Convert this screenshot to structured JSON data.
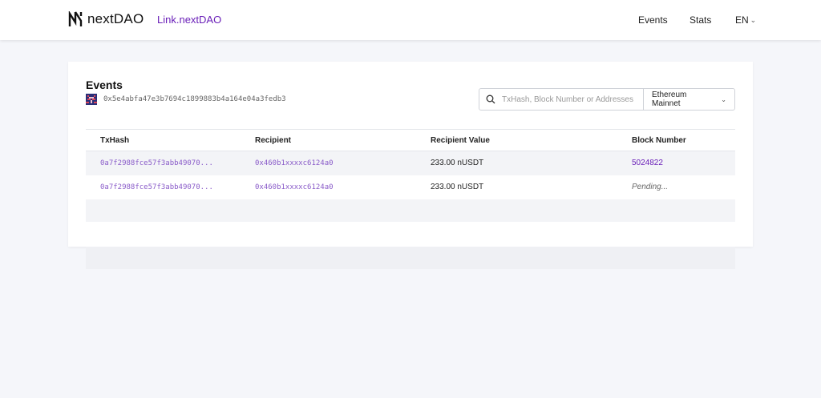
{
  "header": {
    "brand": "nextDAO",
    "link_label": "Link.nextDAO",
    "nav": {
      "events": "Events",
      "stats": "Stats",
      "language": "EN"
    }
  },
  "events_panel": {
    "title": "Events",
    "address": "0x5e4abfa47e3b7694c1899883b4a164e04a3fedb3",
    "search": {
      "placeholder": "TxHash, Block Number or Addresses",
      "value": ""
    },
    "network": {
      "selected": "Ethereum Mainnet"
    },
    "table": {
      "columns": [
        "TxHash",
        "Recipient",
        "Recipient Value",
        "Block Number"
      ],
      "rows": [
        {
          "txhash": "0a7f2988fce57f3abb49070...",
          "recipient": "0x460b1xxxxc6124a0",
          "value": "233.00 nUSDT",
          "block": "5024822"
        },
        {
          "txhash": "0a7f2988fce57f3abb49070...",
          "recipient": "0x460b1xxxxc6124a0",
          "value": "233.00 nUSDT",
          "block": "Pending..."
        }
      ]
    }
  },
  "colors": {
    "accent": "#6a1fb8",
    "hash": "#8a5cc9",
    "background": "#f5f6fa"
  }
}
